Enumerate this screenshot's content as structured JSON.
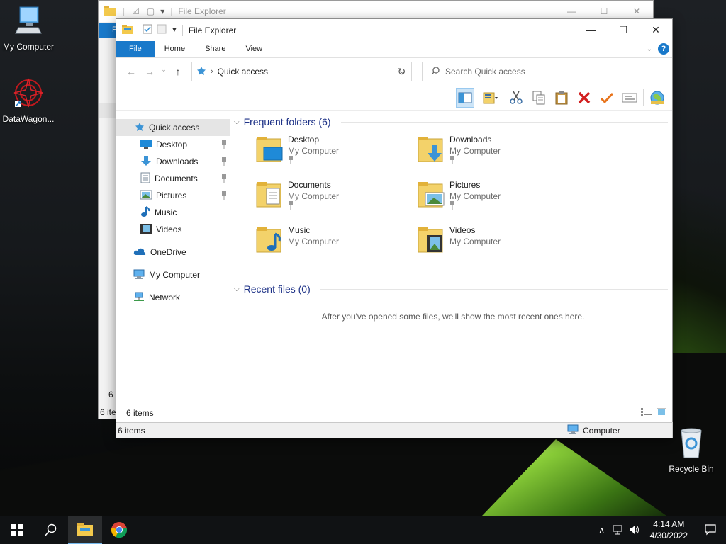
{
  "desktop": {
    "icons": [
      {
        "label": "My Computer"
      },
      {
        "label": "DataWagon..."
      },
      {
        "label": "Recycle Bin"
      }
    ]
  },
  "back_window": {
    "title": "File Explorer",
    "file_tab": "F",
    "status_left": "6 ite",
    "status_left2": "6 i"
  },
  "window": {
    "title": "File Explorer",
    "ribbon_tabs": [
      "File",
      "Home",
      "Share",
      "View"
    ],
    "address": {
      "location": "Quick access"
    },
    "search": {
      "placeholder": "Search Quick access"
    },
    "nav": {
      "items": [
        {
          "label": "Quick access"
        },
        {
          "label": "Desktop"
        },
        {
          "label": "Downloads"
        },
        {
          "label": "Documents"
        },
        {
          "label": "Pictures"
        },
        {
          "label": "Music"
        },
        {
          "label": "Videos"
        },
        {
          "label": "OneDrive"
        },
        {
          "label": "My Computer"
        },
        {
          "label": "Network"
        }
      ]
    },
    "frequent": {
      "header": "Frequent folders (6)",
      "folders": [
        {
          "name": "Desktop",
          "location": "My Computer"
        },
        {
          "name": "Downloads",
          "location": "My Computer"
        },
        {
          "name": "Documents",
          "location": "My Computer"
        },
        {
          "name": "Pictures",
          "location": "My Computer"
        },
        {
          "name": "Music",
          "location": "My Computer"
        },
        {
          "name": "Videos",
          "location": "My Computer"
        }
      ]
    },
    "recent": {
      "header": "Recent files (0)",
      "empty_message": "After you've opened some files, we'll show the most recent ones here."
    },
    "status": {
      "items": "6 items"
    },
    "status_bar": {
      "items": "6 items",
      "zone": "Computer"
    }
  },
  "taskbar": {
    "time": "4:14 AM",
    "date": "4/30/2022"
  },
  "colors": {
    "accent": "#1979ca",
    "header_text": "#1e3287"
  }
}
